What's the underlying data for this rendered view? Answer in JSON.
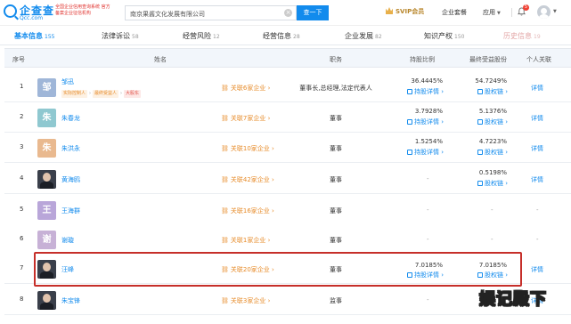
{
  "header": {
    "logo_name": "企查查",
    "logo_domain": "Qcc.com",
    "slogan": "全国企业信用查询系统 官方备案企业征信机构",
    "search_value": "南京果酱文化发展有限公司",
    "search_clear": "×",
    "search_button": "查一下",
    "svip_label": "SVIP会员",
    "nav": [
      "企业套餐",
      "应用"
    ],
    "bell_count": "5"
  },
  "tabs": [
    {
      "label": "基本信息",
      "count": "155",
      "active": true
    },
    {
      "label": "法律诉讼",
      "count": "58"
    },
    {
      "label": "经营风险",
      "count": "12"
    },
    {
      "label": "经营信息",
      "count": "28"
    },
    {
      "label": "企业发展",
      "count": "82"
    },
    {
      "label": "知识产权",
      "count": "150"
    },
    {
      "label": "历史信息",
      "count": "19",
      "faded": true
    }
  ],
  "table": {
    "headers": [
      "序号",
      "姓名",
      "职务",
      "持股比例",
      "最终受益股份",
      "个人关联"
    ],
    "rows": [
      {
        "seq": "1",
        "avatar_text": "邹",
        "avatar_color": "#9fb6d8",
        "name": "邹迅",
        "tags": [
          "实际控制人",
          "最终受益人",
          "大股东"
        ],
        "related": "关联6家企业",
        "role": "董事长,总经理,法定代表人",
        "hold_pct": "36.4445%",
        "hold_link": "持股详情",
        "benefit_pct": "54.7249%",
        "benefit_link": "股权链",
        "detail": "详情"
      },
      {
        "seq": "2",
        "avatar_text": "朱",
        "avatar_color": "#8fc8d0",
        "name": "朱春龙",
        "related": "关联7家企业",
        "role": "董事",
        "hold_pct": "3.7928%",
        "hold_link": "持股详情",
        "benefit_pct": "5.1376%",
        "benefit_link": "股权链",
        "detail": "详情"
      },
      {
        "seq": "3",
        "avatar_text": "朱",
        "avatar_color": "#e9b98f",
        "name": "朱洪永",
        "related": "关联10家企业",
        "role": "董事",
        "hold_pct": "1.5254%",
        "hold_link": "持股详情",
        "benefit_pct": "4.7223%",
        "benefit_link": "股权链",
        "detail": "详情"
      },
      {
        "seq": "4",
        "avatar_text": "",
        "avatar_photo": true,
        "name": "黄海鸥",
        "related": "关联42家企业",
        "role": "董事",
        "hold_pct": "-",
        "benefit_pct": "0.5198%",
        "benefit_link": "股权链",
        "detail": "详情"
      },
      {
        "seq": "5",
        "avatar_text": "王",
        "avatar_color": "#b9a6d9",
        "name": "王海群",
        "related": "关联16家企业",
        "role": "董事",
        "hold_pct": "-",
        "benefit_pct": "-",
        "detail": "-"
      },
      {
        "seq": "6",
        "avatar_text": "谢",
        "avatar_color": "#c7b1d6",
        "name": "谢璇",
        "related": "关联1家企业",
        "role": "董事",
        "hold_pct": "-",
        "benefit_pct": "-",
        "detail": "-"
      },
      {
        "seq": "7",
        "avatar_text": "",
        "avatar_photo": true,
        "name": "汪峰",
        "related": "关联20家企业",
        "role": "董事",
        "hold_pct": "7.0185%",
        "hold_link": "持股详情",
        "benefit_pct": "7.0185%",
        "benefit_link": "股权链",
        "detail": "详情"
      },
      {
        "seq": "8",
        "avatar_text": "",
        "avatar_photo": true,
        "name": "朱宝锋",
        "related": "关联3家企业",
        "role": "监事",
        "hold_pct": "-",
        "benefit_pct": "-",
        "detail": "详情"
      }
    ]
  },
  "watermark": "娱记殿下",
  "colors": {
    "accent": "#128bed",
    "orange": "#e78c2b",
    "highlight": "#c62f2a"
  }
}
